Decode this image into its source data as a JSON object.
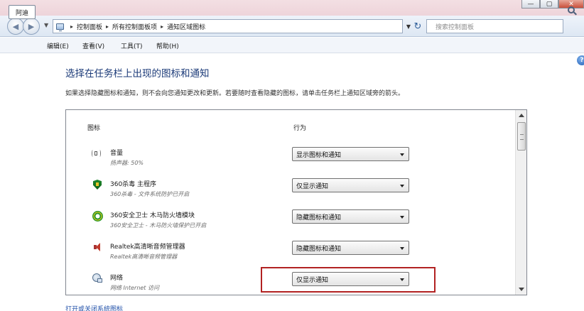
{
  "window": {
    "controls": {
      "minimize": "—",
      "maximize": "▢",
      "close": "✕"
    }
  },
  "nav": {
    "breadcrumbs": [
      "控制面板",
      "所有控制面板项",
      "通知区域图标"
    ],
    "search_placeholder": "搜索控制面板"
  },
  "menu": {
    "active_tab": "阿迪",
    "items": [
      "编辑(E)",
      "查看(V)",
      "工具(T)",
      "帮助(H)"
    ]
  },
  "main": {
    "heading": "选择在任务栏上出现的图标和通知",
    "description": "如果选择隐藏图标和通知，则不会向您通知更改和更新。若要随时查看隐藏的图标，请单击任务栏上通知区域旁的箭头。",
    "columns": {
      "icon": "图标",
      "behavior": "行为"
    },
    "rows": [
      {
        "icon": "speaker-icon",
        "name": "音量",
        "subtitle": "扬声器: 50%",
        "behavior": "显示图标和通知"
      },
      {
        "icon": "360-shield-icon",
        "name": "360杀毒 主程序",
        "subtitle": "360杀毒 - 文件系统防护已开启",
        "behavior": "仅显示通知"
      },
      {
        "icon": "360-safeguard-icon",
        "name": "360安全卫士 木马防火墙模块",
        "subtitle": "360安全卫士 - 木马防火墙保护已开启",
        "behavior": "隐藏图标和通知"
      },
      {
        "icon": "realtek-audio-icon",
        "name": "Realtek高清晰音频管理器",
        "subtitle": "Realtek高清晰音频管理器",
        "behavior": "隐藏图标和通知"
      },
      {
        "icon": "network-icon",
        "name": "网络",
        "subtitle": "网络 Internet 访问",
        "behavior": "仅显示通知"
      }
    ],
    "footer_link": "打开或关闭系统图标",
    "highlight_color": "#b22222"
  }
}
